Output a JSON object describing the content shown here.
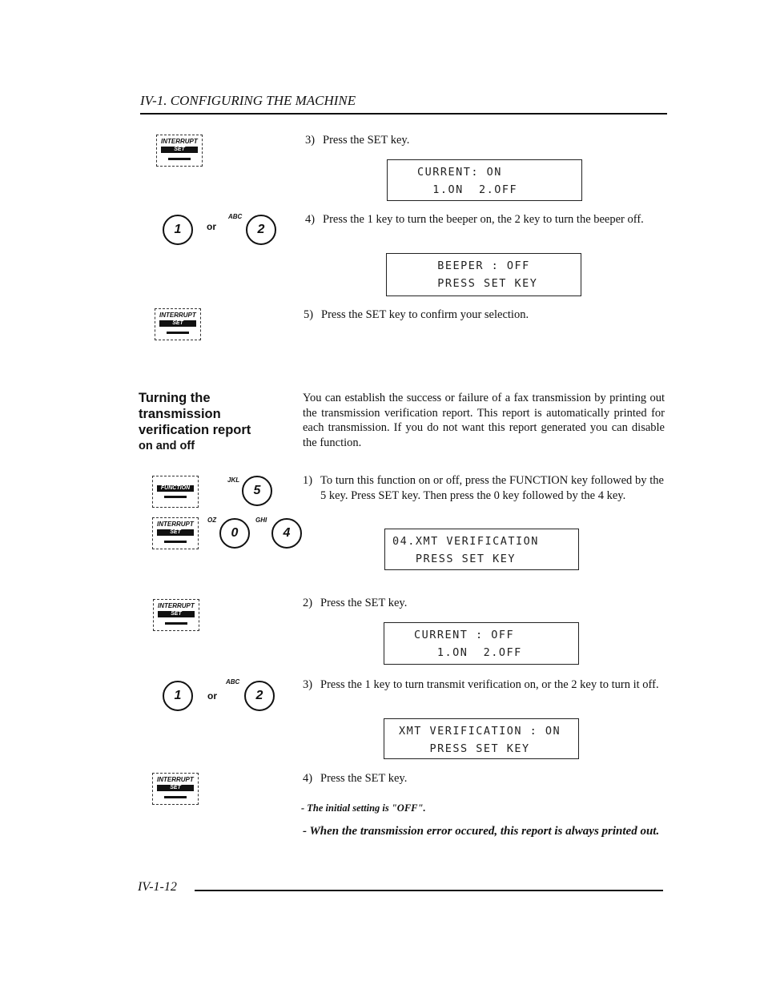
{
  "header": {
    "title": "IV-1. CONFIGURING THE MACHINE"
  },
  "footer": {
    "page_number": "IV-1-12"
  },
  "keys": {
    "interrupt": "INTERRUPT",
    "set": "SET",
    "function": "FUNCTION",
    "or": "or",
    "k1": "1",
    "k2": "2",
    "k5": "5",
    "k0": "0",
    "k4": "4",
    "abc": "ABC",
    "jkl": "JKL",
    "oz": "OZ",
    "ghi": "GHI"
  },
  "beeper_steps": [
    {
      "num": "3)",
      "text": "Press the SET key.",
      "lcd": [
        "CURRENT: ON",
        "  1.ON  2.OFF"
      ]
    },
    {
      "num": "4)",
      "text": "Press the 1 key to turn the beeper on, the 2 key to turn the beeper off.",
      "lcd": [
        "  BEEPER : OFF",
        "  PRESS SET KEY"
      ]
    },
    {
      "num": "5)",
      "text": "Press the SET key to confirm your selection."
    }
  ],
  "section": {
    "title": "Turning the transmission verification report",
    "subtitle": "on and off",
    "intro": "You can establish the success or failure of a fax transmission by printing out the transmission verification report. This report is automatically printed for each transmission. If you do not want this report generated you can disable the function."
  },
  "xmt_steps": [
    {
      "num": "1)",
      "text": "To turn this function on or off, press the FUNCTION key followed by the 5 key. Press SET key. Then press the 0 key followed by the 4 key.",
      "lcd": [
        "04.XMT VERIFICATION",
        "   PRESS SET KEY"
      ]
    },
    {
      "num": "2)",
      "text": "Press the SET key.",
      "lcd": [
        "CURRENT : OFF",
        "   1.ON  2.OFF"
      ]
    },
    {
      "num": "3)",
      "text": "Press the 1 key to turn transmit verification on, or the 2 key to turn it off.",
      "lcd": [
        "XMT VERIFICATION : ON",
        "    PRESS SET KEY"
      ]
    },
    {
      "num": "4)",
      "text": "Press the SET key."
    }
  ],
  "notes": [
    "- The initial setting is \"OFF\".",
    "- When the transmission error occured, this report is always printed out."
  ]
}
